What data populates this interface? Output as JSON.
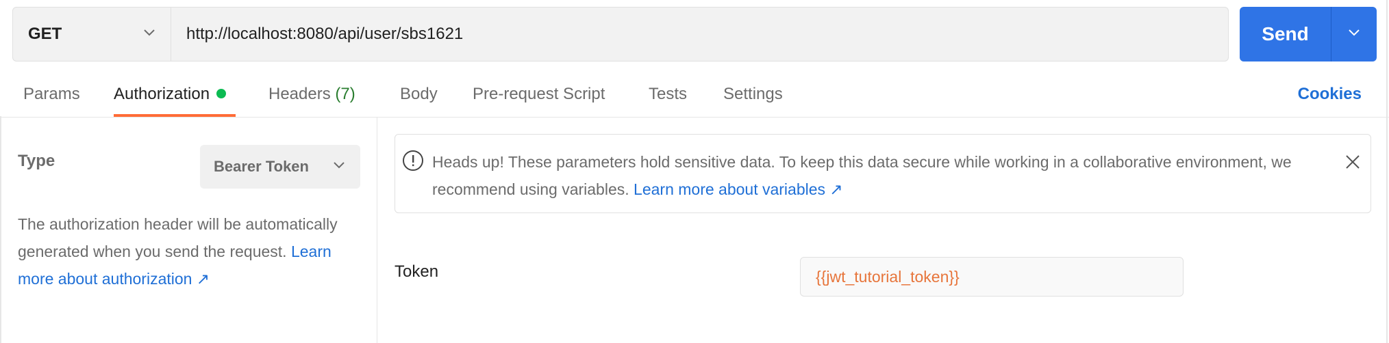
{
  "request": {
    "method": "GET",
    "url": "http://localhost:8080/api/user/sbs1621",
    "send_label": "Send"
  },
  "tabs": [
    {
      "label": "Params"
    },
    {
      "label": "Authorization"
    },
    {
      "label": "Headers",
      "count": "(7)"
    },
    {
      "label": "Body"
    },
    {
      "label": "Pre-request Script"
    },
    {
      "label": "Tests"
    },
    {
      "label": "Settings"
    }
  ],
  "cookies_label": "Cookies",
  "auth": {
    "type_label": "Type",
    "type_value": "Bearer Token",
    "description": "The authorization header will be automatically generated when you send the request.",
    "learn_more": "Learn more about authorization ↗"
  },
  "notice": {
    "text": "Heads up! These parameters hold sensitive data. To keep this data secure while working in a collaborative environment, we recommend using variables.",
    "link": "Learn more about variables ↗"
  },
  "token": {
    "label": "Token",
    "value": "{{jwt_tutorial_token}}"
  },
  "colors": {
    "accent": "#ff6c37",
    "send": "#2f74e6",
    "link": "#1f6fd6",
    "status_dot": "#0cbb52",
    "variable": "#e7753b"
  },
  "icons": [
    "chevron-down-icon",
    "alert-circle-icon",
    "close-icon"
  ]
}
